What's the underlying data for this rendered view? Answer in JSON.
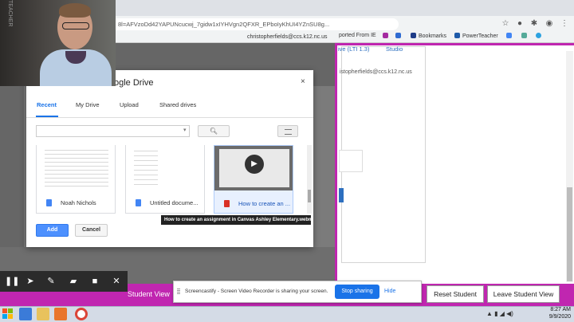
{
  "browser": {
    "url": "8l=AFVzoDd42YAPUNcucwj_7gidw1xIYHVgn2QFXR_EPboIyKhUI4YZnSU8g...",
    "user_email": "christopherfields@ccs.k12.nc.us",
    "bookmarks": [
      "ported From IE",
      "Bookmarks",
      "PowerTeacher"
    ]
  },
  "canvas": {
    "tab_lti": "ive (LTI 1.3)",
    "tab_studio": "Studio",
    "user_email": "istopherfields@ccs.k12.nc.us",
    "student_view": "Student View",
    "reset_student": "Reset Student",
    "leave_student": "Leave Student View"
  },
  "picker": {
    "title": "ogle Drive",
    "close": "×",
    "tabs": [
      "Recent",
      "My Drive",
      "Upload",
      "Shared drives"
    ],
    "files": [
      {
        "name": "Noah Nichols",
        "icon_color": "#4285f4"
      },
      {
        "name": "Untitled docume...",
        "icon_color": "#4285f4"
      },
      {
        "name": "How to create an ...",
        "icon_color": "#d93025"
      }
    ],
    "tooltip": "How to create an assignment in Canvas Ashley Elementary.webm",
    "add": "Add",
    "cancel": "Cancel"
  },
  "webcam": {
    "sign": "TEACHER"
  },
  "screencastify": {
    "message": "Screencastify - Screen Video Recorder is sharing your screen.",
    "stop": "Stop sharing",
    "hide": "Hide"
  },
  "taskbar": {
    "time": "8:27 AM",
    "date": "9/9/2020"
  },
  "colors": {
    "accent": "#c026b0",
    "google_blue": "#4d90fe",
    "share_blue": "#1a73e8"
  }
}
